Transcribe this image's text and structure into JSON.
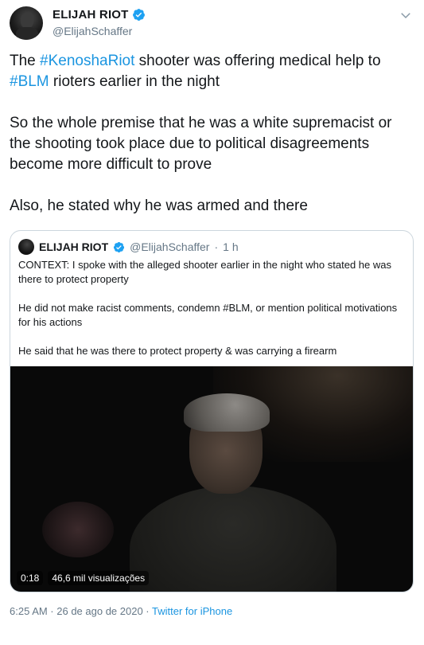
{
  "author": {
    "name": "ELIJAH RIOT",
    "handle": "@ElijahSchaffer"
  },
  "tweet": {
    "line1_pre": "The ",
    "line1_tag1": "#KenoshaRiot",
    "line1_mid": " shooter was offering medical help to ",
    "line1_tag2": "#BLM",
    "line1_post": " rioters earlier in the night",
    "para2": "So the whole premise that he was a white supremacist or the shooting took place due to political disagreements become more difficult to prove",
    "para3": "Also, he stated why he was armed and there"
  },
  "quote": {
    "name": "ELIJAH RIOT",
    "handle": "@ElijahSchaffer",
    "dot": "·",
    "time": "1 h",
    "para1": "CONTEXT: I spoke with the alleged shooter earlier in the night who stated he was there to protect property",
    "para2": "He did not make racist comments, condemn #BLM, or mention political motivations for his actions",
    "para3": "He said that he was there to protect property & was carrying a firearm",
    "video": {
      "duration": "0:18",
      "views": "46,6 mil visualizações"
    }
  },
  "footer": {
    "timestamp": "6:25 AM · 26 de ago de 2020 ·",
    "source": "Twitter for iPhone"
  },
  "colors": {
    "accent": "#1b95e0",
    "verified": "#1da1f2",
    "muted": "#657786",
    "border": "#ccd6dd"
  },
  "icons": {
    "verified": "verified-badge-icon",
    "menu": "chevron-down-icon"
  }
}
